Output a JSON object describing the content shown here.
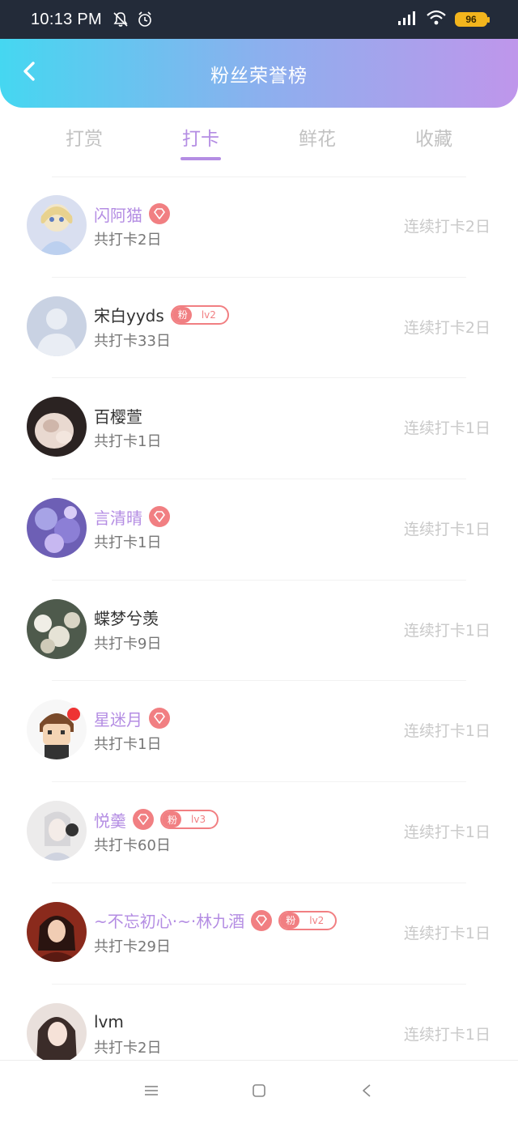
{
  "status_bar": {
    "time": "10:13 PM",
    "battery": "96",
    "icons": [
      "bell-off-icon",
      "alarm-icon",
      "signal-icon",
      "wifi-icon",
      "battery-icon"
    ]
  },
  "header": {
    "title": "粉丝荣誉榜",
    "back_icon": "chevron-left-icon"
  },
  "tabs": [
    {
      "label": "打赏",
      "active": false
    },
    {
      "label": "打卡",
      "active": true
    },
    {
      "label": "鲜花",
      "active": false
    },
    {
      "label": "收藏",
      "active": false
    }
  ],
  "colors": {
    "accent": "#b48de3",
    "header_gradient": [
      "#45d7f1",
      "#bf96eb"
    ],
    "badge": "#f17f82",
    "muted": "#c9c9c9"
  },
  "list": [
    {
      "name": "闪阿猫",
      "vip": true,
      "fan_level": "",
      "total": "共打卡2日",
      "streak": "连续打卡2日",
      "avatar": "anime-girl-avatar"
    },
    {
      "name": "宋白yyds",
      "vip": false,
      "fan_level": "lv2",
      "total": "共打卡33日",
      "streak": "连续打卡2日",
      "avatar": "default-avatar"
    },
    {
      "name": "百樱萱",
      "vip": false,
      "fan_level": "",
      "total": "共打卡1日",
      "streak": "连续打卡1日",
      "avatar": "photo-avatar"
    },
    {
      "name": "言清晴",
      "vip": true,
      "fan_level": "",
      "total": "共打卡1日",
      "streak": "连续打卡1日",
      "avatar": "flower-art-avatar"
    },
    {
      "name": "蝶梦兮羡",
      "vip": false,
      "fan_level": "",
      "total": "共打卡9日",
      "streak": "连续打卡1日",
      "avatar": "flowers-avatar"
    },
    {
      "name": "星迷月",
      "vip": true,
      "fan_level": "",
      "total": "共打卡1日",
      "streak": "连续打卡1日",
      "avatar": "cartoon-boy-avatar"
    },
    {
      "name": "悦羹",
      "vip": true,
      "fan_level": "lv3",
      "total": "共打卡60日",
      "streak": "连续打卡1日",
      "avatar": "headphone-girl-avatar"
    },
    {
      "name": "~不忘初心·~·林九酒",
      "vip": true,
      "fan_level": "lv2",
      "total": "共打卡29日",
      "streak": "连续打卡1日",
      "avatar": "portrait-avatar"
    },
    {
      "name": "lvm",
      "vip": false,
      "fan_level": "",
      "total": "共打卡2日",
      "streak": "连续打卡1日",
      "avatar": "girl-photo-avatar"
    }
  ],
  "fan_badge_label": "粉",
  "nav": [
    "menu-icon",
    "home-square-icon",
    "back-triangle-icon"
  ]
}
